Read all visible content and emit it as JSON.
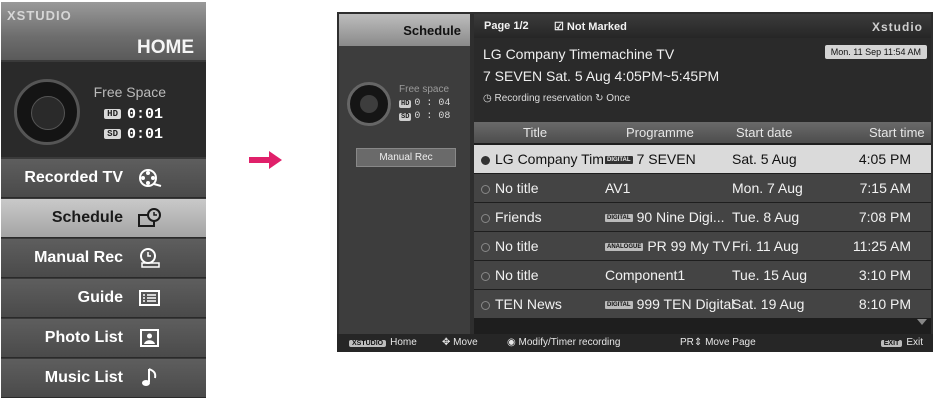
{
  "home": {
    "logo": "XSTUDIO",
    "title": "HOME",
    "free_space_label": "Free Space",
    "hd_tag": "HD",
    "sd_tag": "SD",
    "hd_time": "0:01",
    "sd_time": "0:01",
    "menu": [
      {
        "label": "Recorded TV",
        "icon": "film-reel-icon"
      },
      {
        "label": "Schedule",
        "icon": "schedule-clock-icon"
      },
      {
        "label": "Manual Rec",
        "icon": "manual-rec-clock-icon"
      },
      {
        "label": "Guide",
        "icon": "guide-list-icon"
      },
      {
        "label": "Photo List",
        "icon": "photo-icon"
      },
      {
        "label": "Music List",
        "icon": "music-note-icon"
      }
    ],
    "active_index": 1
  },
  "arrow_color": "#e0206a",
  "schedule": {
    "sidebar_title": "Schedule",
    "free_space_label": "Free space",
    "hd_tag": "HD",
    "sd_tag": "SD",
    "hd_time": "0 : 04",
    "sd_time": "0 : 08",
    "manual_rec_label": "Manual Rec",
    "page_label": "Page  1/2",
    "not_marked_label": "Not Marked",
    "logo": "Xstudio",
    "info": {
      "title": "LG Company Timemachine TV",
      "subtitle": "7 SEVEN   Sat. 5 Aug  4:05PM~5:45PM",
      "reservation": "Recording reservation",
      "repeat": "Once",
      "clock": "Mon. 11 Sep   11:54 AM"
    },
    "columns": [
      "Title",
      "Programme",
      "Start date",
      "Start time"
    ],
    "rows": [
      {
        "title": "LG Company Tim...",
        "badge": "DIGITAL",
        "programme": "7 SEVEN",
        "date": "Sat.  5  Aug",
        "time": "4:05 PM"
      },
      {
        "title": "No title",
        "badge": "",
        "programme": "AV1",
        "date": "Mon.  7  Aug",
        "time": "7:15 AM"
      },
      {
        "title": "Friends",
        "badge": "DIGITAL",
        "programme": "90 Nine Digi...",
        "date": "Tue.  8  Aug",
        "time": "7:08 PM"
      },
      {
        "title": "No title",
        "badge": "ANALOGUE",
        "programme": "PR 99 My TV",
        "date": "Fri.  11  Aug",
        "time": "11:25 AM"
      },
      {
        "title": "No title",
        "badge": "",
        "programme": "Component1",
        "date": "Tue.  15  Aug",
        "time": "3:10 PM"
      },
      {
        "title": "TEN News",
        "badge": "DIGITAL",
        "programme": "999 TEN Digital",
        "date": "Sat.  19  Aug",
        "time": "8:10 PM"
      }
    ],
    "selected_index": 0,
    "footer": {
      "home_key": "XSTUDIO",
      "home": "Home",
      "move": "Move",
      "modify": "Modify/Timer recording",
      "pr_key": "PR",
      "move_page": "Move Page",
      "exit_key": "EXIT",
      "exit": "Exit"
    }
  }
}
